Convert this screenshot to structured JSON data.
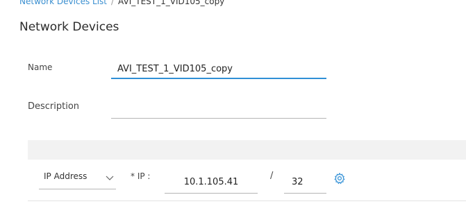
{
  "breadcrumb": {
    "parent": "Network Devices List",
    "separator": "/",
    "current": "AVI_TEST_1_VID105_copy"
  },
  "page_title": "Network Devices",
  "form": {
    "name_label": "Name",
    "name_value": "AVI_TEST_1_VID105_copy",
    "description_label": "Description",
    "description_value": ""
  },
  "ip_section": {
    "type_selected": "IP Address",
    "ip_label": "* IP :",
    "ip_value": "10.1.105.41",
    "mask_separator": "/",
    "mask_value": "32"
  },
  "icons": {
    "type_dropdown": "chevron-down-icon",
    "settings": "gear-icon"
  },
  "colors": {
    "link": "#3a8fd0",
    "focus_underline": "#2f8fd6",
    "band": "#f2f2f2"
  }
}
